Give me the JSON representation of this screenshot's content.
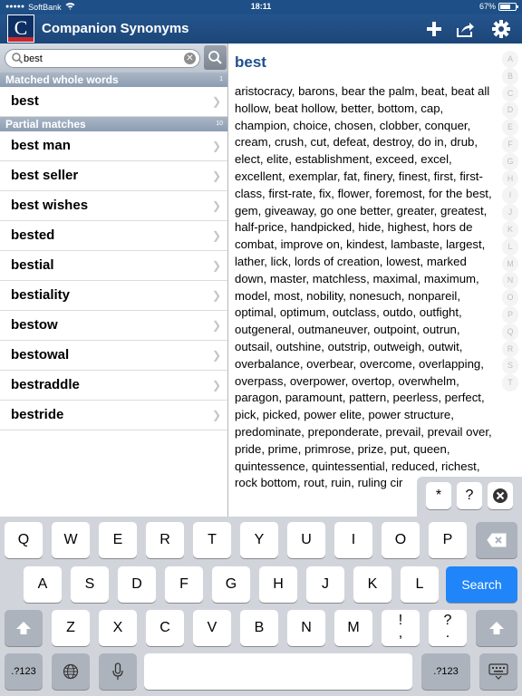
{
  "statusbar": {
    "carrier": "SoftBank",
    "time": "18:11",
    "battery": "67%",
    "battery_level": 0.67
  },
  "navbar": {
    "logo_letter": "C",
    "title": "Companion Synonyms",
    "icons": [
      "plus-icon",
      "share-icon",
      "gear-icon"
    ]
  },
  "search": {
    "value": "best",
    "clear_icon": "clear-icon"
  },
  "sections": [
    {
      "title": "Matched whole words",
      "count": "1",
      "items": [
        "best"
      ]
    },
    {
      "title": "Partial matches",
      "count": "10",
      "items": [
        "best man",
        "best seller",
        "best wishes",
        "bested",
        "bestial",
        "bestiality",
        "bestow",
        "bestowal",
        "bestraddle",
        "bestride"
      ]
    }
  ],
  "entry": {
    "word": "best",
    "synonyms": "aristocracy, barons, bear the palm, beat, beat all hollow, beat hollow, better, bottom, cap, champion, choice, chosen, clobber, conquer, cream, crush, cut, defeat, destroy, do in, drub, elect, elite, establishment, exceed, excel, excellent, exemplar, fat, finery, finest, first, first-class, first-rate, fix, flower, foremost, for the best, gem, giveaway, go one better, greater, greatest, half-price, handpicked, hide, highest, hors de combat, improve on, kindest, lambaste, largest, lather, lick, lords of creation, lowest, marked down, master, matchless, maximal, maximum, model, most, nobility, nonesuch, nonpareil, optimal, optimum, outclass, outdo, outfight, outgeneral, outmaneuver, outpoint, outrun, outsail, outshine, outstrip, outweigh, outwit, overbalance, overbear, overcome, overlapping, overpass, overpower, overtop, overwhelm, paragon, paramount, pattern, peerless, perfect, pick, picked, power elite, power structure, predominate, preponderate, prevail, prevail over, pride, prime, primrose, prize, put, queen, quintessence, quintessential, reduced, richest, rock bottom, rout, ruin, ruling cir"
  },
  "index_letters": [
    "A",
    "B",
    "C",
    "D",
    "E",
    "F",
    "G",
    "H",
    "I",
    "J",
    "K",
    "L",
    "M",
    "N",
    "O",
    "P",
    "Q",
    "R",
    "S",
    "T"
  ],
  "symbol_keys": [
    "*",
    "?",
    "⊗"
  ],
  "keyboard": {
    "row1": [
      "Q",
      "W",
      "E",
      "R",
      "T",
      "Y",
      "U",
      "I",
      "O",
      "P"
    ],
    "row2": [
      "A",
      "S",
      "D",
      "F",
      "G",
      "H",
      "J",
      "K",
      "L"
    ],
    "row3": [
      "Z",
      "X",
      "C",
      "V",
      "B",
      "N",
      "M"
    ],
    "punct1": "!\n,",
    "punct2": "?\n.",
    "search_label": "Search",
    "num_label": ".?123",
    "icons": [
      "backspace-icon",
      "shift-icon",
      "globe-icon",
      "microphone-icon",
      "keyboard-dismiss-icon"
    ]
  }
}
